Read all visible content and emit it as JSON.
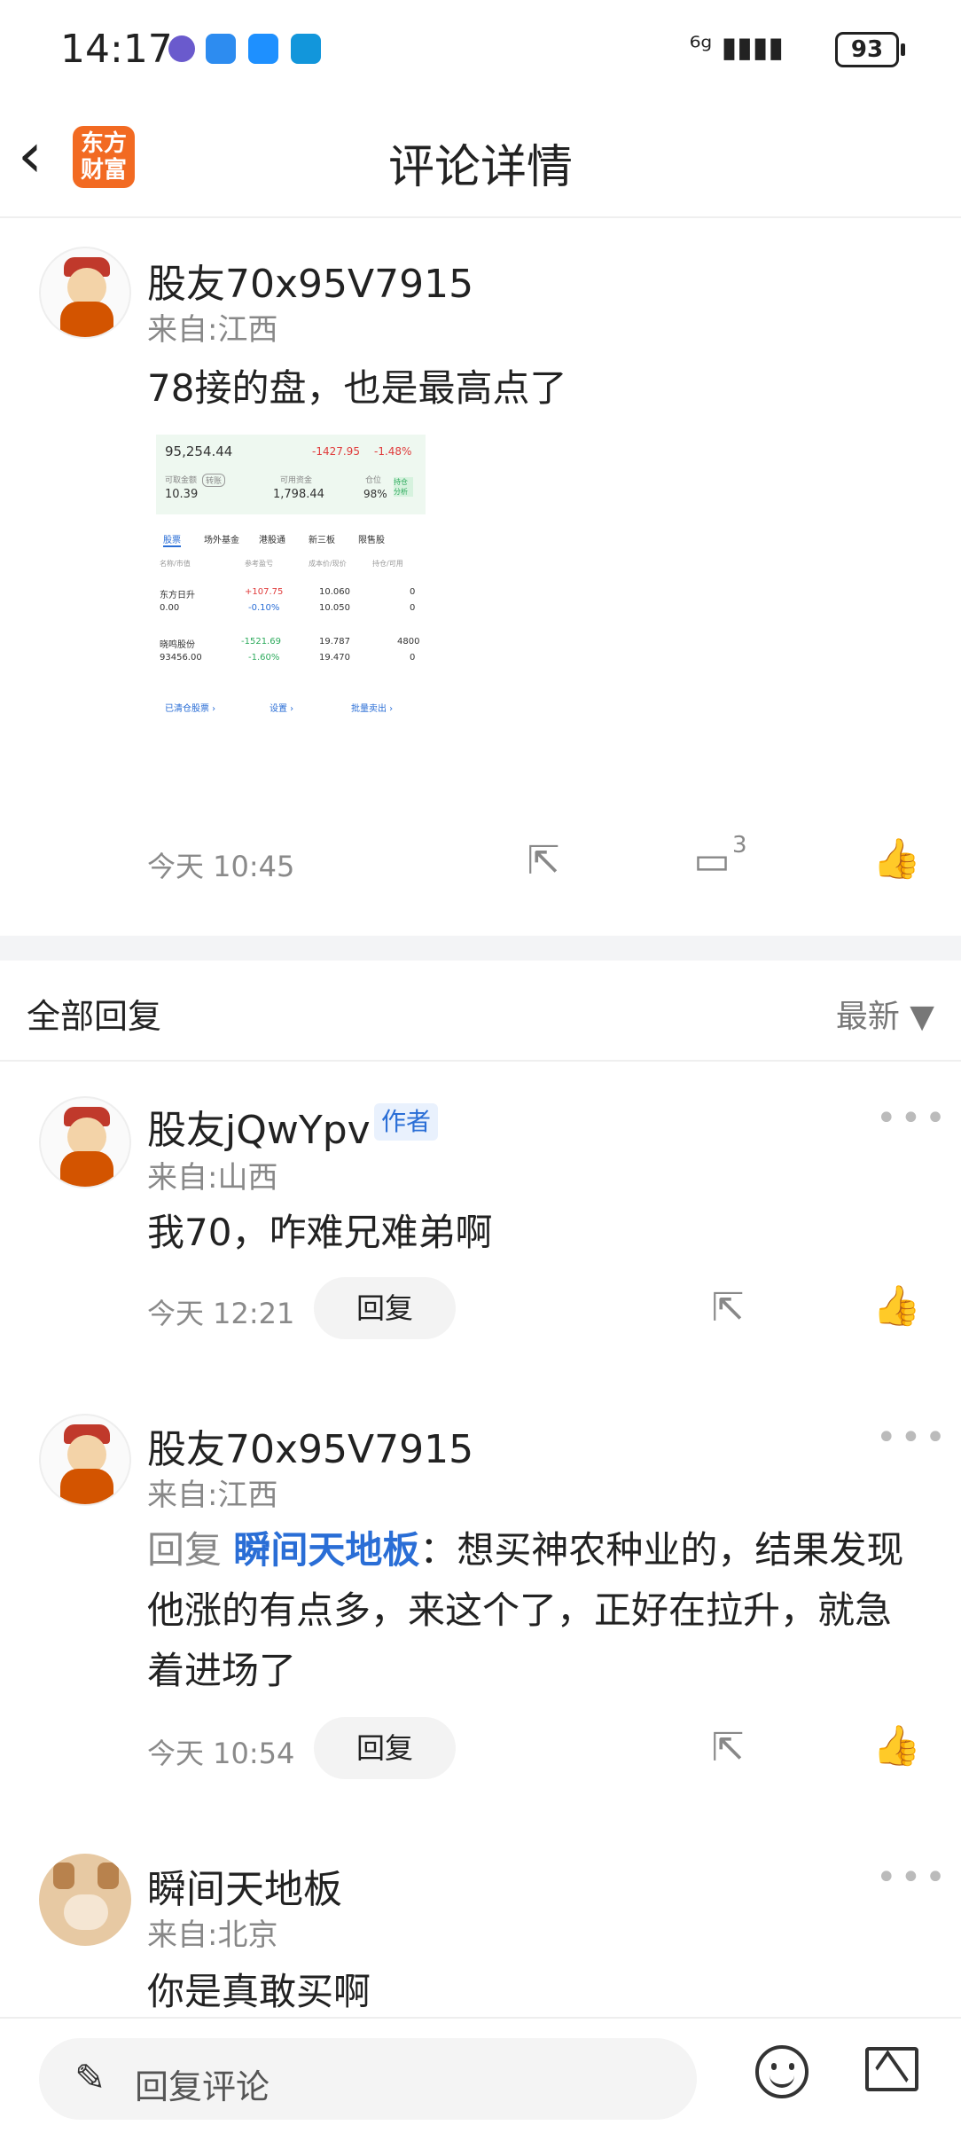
{
  "status": {
    "time": "14:17",
    "signal": "⁶ᵍ ▮▮▮▮",
    "battery": "93"
  },
  "header": {
    "title": "评论详情",
    "logo_text": "东方财富"
  },
  "main_post": {
    "username": "股友70x95V7915",
    "from": "来自:江西",
    "content": "78接的盘，也是最高点了",
    "time": "今天 10:45",
    "comment_count": "3",
    "screenshot": {
      "total": "95,254.44",
      "change": "-1427.95",
      "change_pct": "-1.48%",
      "avail_label": "可取金额",
      "transfer_label": "转账",
      "avail": "10.39",
      "usable_label": "可用资金",
      "usable": "1,798.44",
      "pos_label": "仓位",
      "pos": "98%",
      "analysis_label": "持仓分析",
      "tabs": [
        "股票",
        "场外基金",
        "港股通",
        "新三板",
        "限售股"
      ],
      "col_headers": [
        "名称/市值",
        "参考盈亏",
        "成本价/现价",
        "持仓/可用"
      ],
      "rows": [
        {
          "name": "东方日升",
          "value": "0.00",
          "pnl": "+107.75",
          "pnl_pct": "-0.10%",
          "cost": "10.060",
          "price": "10.050",
          "hold": "0",
          "avail": "0"
        },
        {
          "name": "晓鸣股份",
          "value": "93456.00",
          "pnl": "-1521.69",
          "pnl_pct": "-1.60%",
          "cost": "19.787",
          "price": "19.470",
          "hold": "4800",
          "avail": "0"
        }
      ],
      "links": [
        "已清仓股票 ›",
        "设置 ›",
        "批量卖出 ›"
      ]
    }
  },
  "section": {
    "title": "全部回复",
    "sort": "最新 ▼"
  },
  "replies": [
    {
      "username": "股友jQwYpv",
      "tag": "作者",
      "from": "来自:山西",
      "content": "我70，咋难兄难弟啊",
      "time": "今天 12:21",
      "reply_label": "回复"
    },
    {
      "username": "股友70x95V7915",
      "from": "来自:江西",
      "reply_prefix": "回复",
      "reply_to": "瞬间天地板",
      "content": "：想买神农种业的，结果发现他涨的有点多，来这个了，正好在拉升，就急着进场了",
      "time": "今天 10:54",
      "reply_label": "回复"
    },
    {
      "username": "瞬间天地板",
      "from": "来自:北京",
      "content": "你是真敢买啊"
    }
  ],
  "bottom": {
    "placeholder": "回复评论"
  },
  "icons": [
    "back-icon",
    "share-icon",
    "comment-icon",
    "like-icon",
    "more-icon",
    "pen-icon",
    "emoji-icon",
    "image-icon"
  ]
}
